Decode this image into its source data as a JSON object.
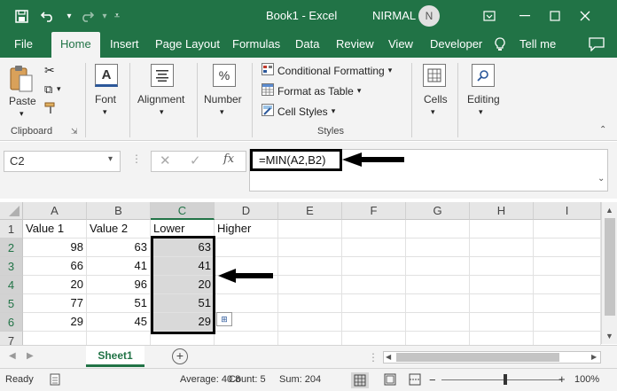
{
  "titlebar": {
    "title": "Book1  -  Excel",
    "user": "NIRMAL",
    "avatar_initial": "N",
    "icons": [
      "save-icon",
      "undo-icon",
      "redo-icon",
      "customize-icon"
    ]
  },
  "tabs": [
    "File",
    "Home",
    "Insert",
    "Page Layout",
    "Formulas",
    "Data",
    "Review",
    "View",
    "Developer",
    "Tell me"
  ],
  "ribbon": {
    "clipboard": {
      "paste": "Paste",
      "group": "Clipboard"
    },
    "font": {
      "label": "Font",
      "icon_text": "A"
    },
    "alignment": {
      "label": "Alignment"
    },
    "number": {
      "label": "Number",
      "icon_text": "%"
    },
    "styles": {
      "conditional": "Conditional Formatting",
      "table": "Format as Table",
      "cell_styles": "Cell Styles",
      "group": "Styles"
    },
    "cells": {
      "label": "Cells"
    },
    "editing": {
      "label": "Editing"
    }
  },
  "formula_bar": {
    "name_box": "C2",
    "fx": "fx",
    "formula": "=MIN(A2,B2)"
  },
  "columns": [
    "A",
    "B",
    "C",
    "D",
    "E",
    "F",
    "G",
    "H",
    "I"
  ],
  "rows": [
    {
      "num": "1",
      "cells": [
        "Value 1",
        "Value 2",
        "Lower",
        "Higher"
      ]
    },
    {
      "num": "2",
      "cells": [
        "98",
        "63",
        "63",
        ""
      ]
    },
    {
      "num": "3",
      "cells": [
        "66",
        "41",
        "41",
        ""
      ]
    },
    {
      "num": "4",
      "cells": [
        "20",
        "96",
        "20",
        ""
      ]
    },
    {
      "num": "5",
      "cells": [
        "77",
        "51",
        "51",
        ""
      ]
    },
    {
      "num": "6",
      "cells": [
        "29",
        "45",
        "29",
        ""
      ]
    },
    {
      "num": "7",
      "cells": [
        "",
        "",
        "",
        ""
      ]
    }
  ],
  "sheet": {
    "active": "Sheet1"
  },
  "status": {
    "ready": "Ready",
    "average": "Average: 40.8",
    "count": "Count: 5",
    "sum": "Sum: 204",
    "zoom": "100%"
  },
  "colors": {
    "brand": "#217346",
    "selection": "#d9d9d9"
  }
}
